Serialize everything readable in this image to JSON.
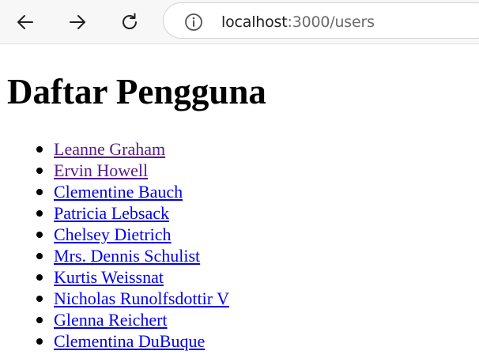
{
  "browser": {
    "url_host": "localhost",
    "url_path": ":3000/users"
  },
  "page": {
    "title": "Daftar Pengguna",
    "users": [
      {
        "name": "Leanne Graham",
        "visited": true
      },
      {
        "name": "Ervin Howell",
        "visited": true
      },
      {
        "name": "Clementine Bauch",
        "visited": false
      },
      {
        "name": "Patricia Lebsack",
        "visited": false
      },
      {
        "name": "Chelsey Dietrich",
        "visited": false
      },
      {
        "name": "Mrs. Dennis Schulist",
        "visited": false
      },
      {
        "name": "Kurtis Weissnat",
        "visited": false
      },
      {
        "name": "Nicholas Runolfsdottir V",
        "visited": false
      },
      {
        "name": "Glenna Reichert",
        "visited": false
      },
      {
        "name": "Clementina DuBuque",
        "visited": false
      }
    ]
  },
  "colors": {
    "link": "#0000ee",
    "link_visited": "#551a8b",
    "toolbar_bg": "#f7f7f7"
  }
}
